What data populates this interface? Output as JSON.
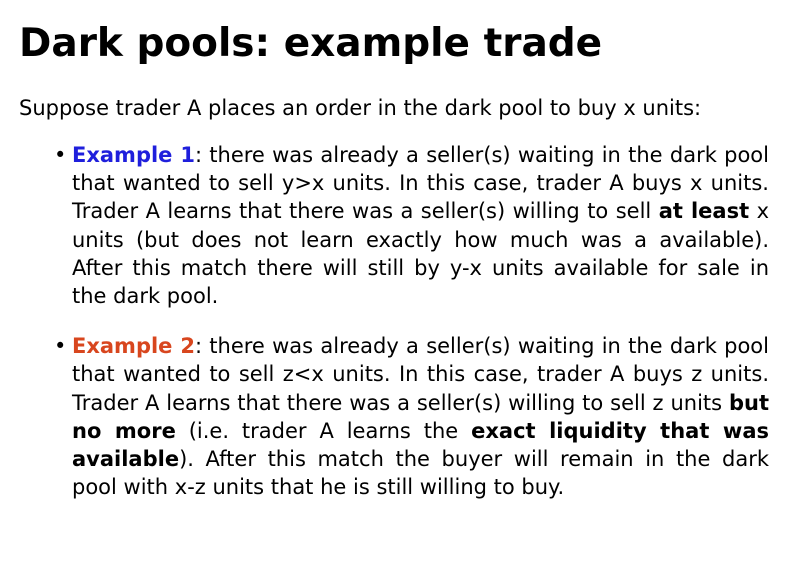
{
  "title": "Dark pools: example trade",
  "intro": "Suppose trader A places an order in the dark pool to buy x units:",
  "bullet_glyph": "•",
  "colors": {
    "example_1_label": "#1f1fdc",
    "example_2_label": "#d8461e",
    "text": "#000000",
    "background": "#ffffff"
  },
  "examples": [
    {
      "label": "Example 1",
      "t1": ": there was already a seller(s) waiting in the dark pool that wanted to sell y>x units. In this case, trader A buys x units. Trader A learns that there was a seller(s) willing to sell ",
      "b1": "at least",
      "t2": " x units (but does not learn exactly how much was a available). After this match there will still by y-x units available for sale in the dark pool."
    },
    {
      "label": "Example 2",
      "t1": ": there was already a seller(s) waiting in the dark pool that wanted to sell z<x units. In this case, trader A buys z units. Trader A learns that there was a seller(s) willing to sell z units ",
      "b1": "but no more",
      "t2": " (i.e. trader A learns the ",
      "b2": "exact liquidity that was available",
      "t3": "). After this match the buyer will remain in the dark pool with x-z units that he is still willing to buy."
    }
  ]
}
